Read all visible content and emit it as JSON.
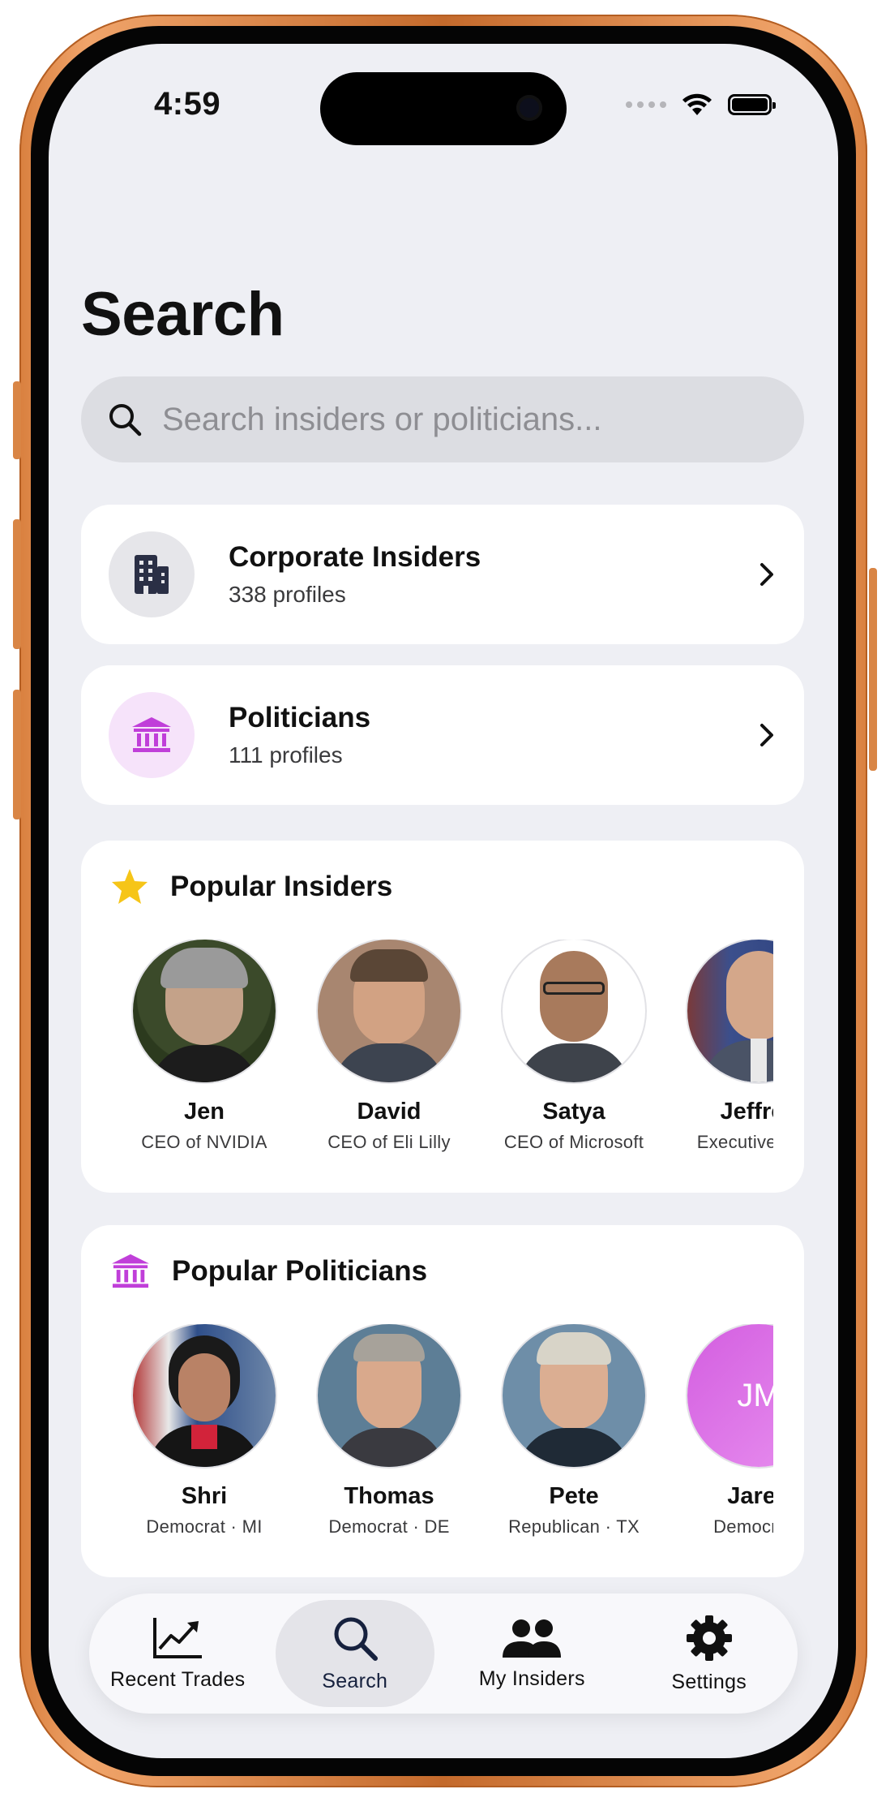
{
  "status_bar": {
    "time": "4:59"
  },
  "page": {
    "title": "Search"
  },
  "search": {
    "placeholder": "Search insiders or politicians..."
  },
  "categories": [
    {
      "title": "Corporate Insiders",
      "subtitle": "338 profiles",
      "icon": "building-icon"
    },
    {
      "title": "Politicians",
      "subtitle": "111 profiles",
      "icon": "capitol-icon"
    }
  ],
  "popular_insiders": {
    "title": "Popular Insiders",
    "icon": "star-icon",
    "people": [
      {
        "name": "Jen",
        "role": "CEO of NVIDIA"
      },
      {
        "name": "David",
        "role": "CEO of Eli Lilly"
      },
      {
        "name": "Satya",
        "role": "CEO of Microsoft"
      },
      {
        "name": "Jeffrey",
        "role": "Executive Ch..."
      }
    ]
  },
  "popular_politicians": {
    "title": "Popular Politicians",
    "icon": "capitol-icon",
    "people": [
      {
        "name": "Shri",
        "role": "Democrat · MI"
      },
      {
        "name": "Thomas",
        "role": "Democrat · DE"
      },
      {
        "name": "Pete",
        "role": "Republican · TX"
      },
      {
        "name": "Jared",
        "role": "Democrat ·",
        "initials": "JM"
      }
    ]
  },
  "tabs": [
    {
      "label": "Recent Trades",
      "icon": "chart-line-icon"
    },
    {
      "label": "Search",
      "icon": "search-icon",
      "active": true
    },
    {
      "label": "My Insiders",
      "icon": "people-icon"
    },
    {
      "label": "Settings",
      "icon": "gear-icon"
    }
  ],
  "colors": {
    "background": "#eeeff4",
    "accent_purple": "#c03fd9",
    "star_yellow": "#f6c518",
    "frame_orange": "#d9803f"
  }
}
